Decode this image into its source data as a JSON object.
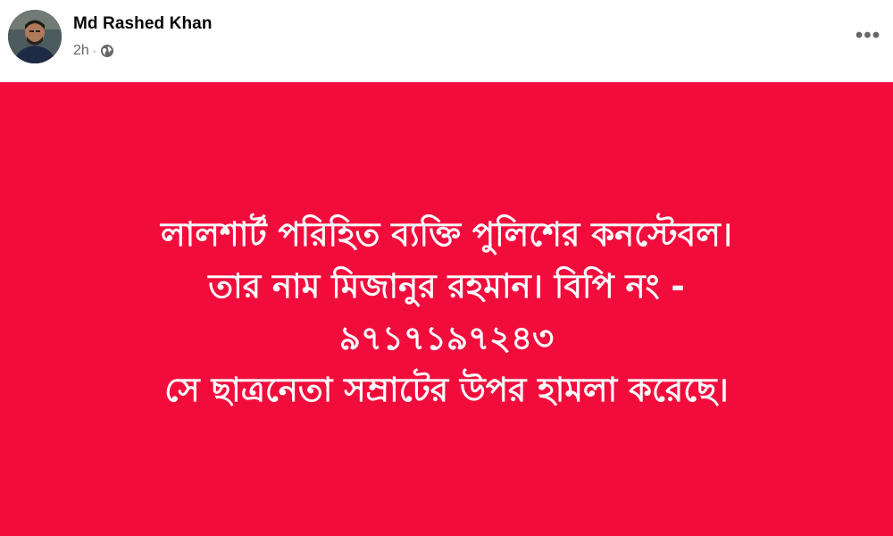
{
  "post": {
    "author": {
      "name": "Md Rashed Khan"
    },
    "meta": {
      "time": "2h",
      "separator": "·",
      "audience_icon": "globe-icon"
    },
    "more_icon": "more-options-icon",
    "more_label": "•••",
    "body": {
      "background_color": "#f20c3c",
      "text_color": "#ffffff",
      "lines": [
        "লালশার্ট পরিহিত ব্যক্তি পুলিশের কনস্টেবল।",
        "তার নাম মিজানুর রহমান। বিপি নং -",
        "৯৭১৭১৯৭২৪৩",
        "সে ছাত্রনেতা সম্রাটের উপর হামলা করেছে।"
      ]
    }
  }
}
